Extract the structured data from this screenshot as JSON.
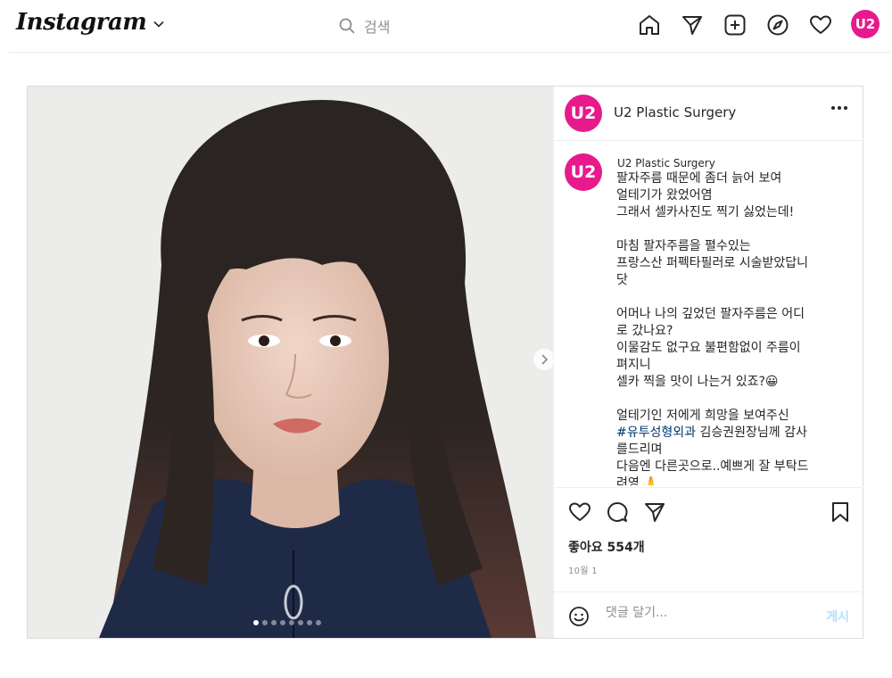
{
  "nav": {
    "brand": "Instagram",
    "search_placeholder": "검색",
    "avatar_text": "U2",
    "icons": [
      "home-icon",
      "direct-icon",
      "new-post-icon",
      "explore-icon",
      "activity-heart-icon"
    ]
  },
  "post": {
    "account": "U2 Plastic Surgery",
    "avatar_text": "U2",
    "caption_user": "U2 Plastic Surgery",
    "caption_before_tag": "팔자주름 때문에 좀더 늙어 보여\n얼테기가 왔었어염\n그래서 셀카사진도 찍기 싫었는데!\n\n마침 팔자주름을 펼수있는\n프랑스산 퍼펙타필러로 시술받았답니\n닷\n\n어머나 나의 깊었던 팔자주름은 어디\n로 갔나요?\n이물감도 없구요 불편함없이 주름이\n펴지니\n셀카 찍을 맛이 나는거 있죠?😀\n\n얼테기인 저에게 희망을 보여주신\n",
    "hashtag": "#유투성형외과",
    "caption_after_tag": " 김승권원장님께 감사\n를드리며\n다음엔 다른곳으로..예쁘게 잘 부탁드\n려영 🙏",
    "likes": "좋아요 554개",
    "date": "10월 1",
    "comment_placeholder": "댓글 달기...",
    "post_button": "게시",
    "carousel": {
      "count": 8,
      "active_index": 0
    }
  },
  "colors": {
    "brand_pink": "#e8198b",
    "link_blue": "#00376b",
    "post_disabled": "#b2dffc"
  }
}
